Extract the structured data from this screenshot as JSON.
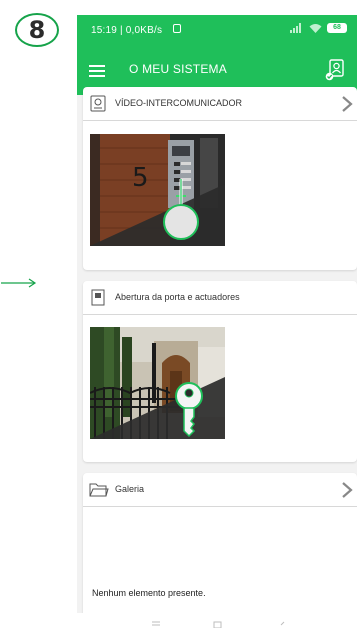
{
  "step_number": "8",
  "status_bar": {
    "time": "15:19 | 0,0KB/s",
    "battery": "68"
  },
  "app_bar": {
    "title": "O MEU SISTEMA"
  },
  "cards": [
    {
      "title": "VÍDEO-INTERCOMUNICADOR",
      "house_number": "5"
    },
    {
      "title": "Abertura da porta e actuadores"
    },
    {
      "title": "Galeria",
      "empty_message": "Nenhum elemento presente."
    }
  ],
  "colors": {
    "brand_green": "#1fbf5a",
    "accent_green": "#16a34a"
  }
}
